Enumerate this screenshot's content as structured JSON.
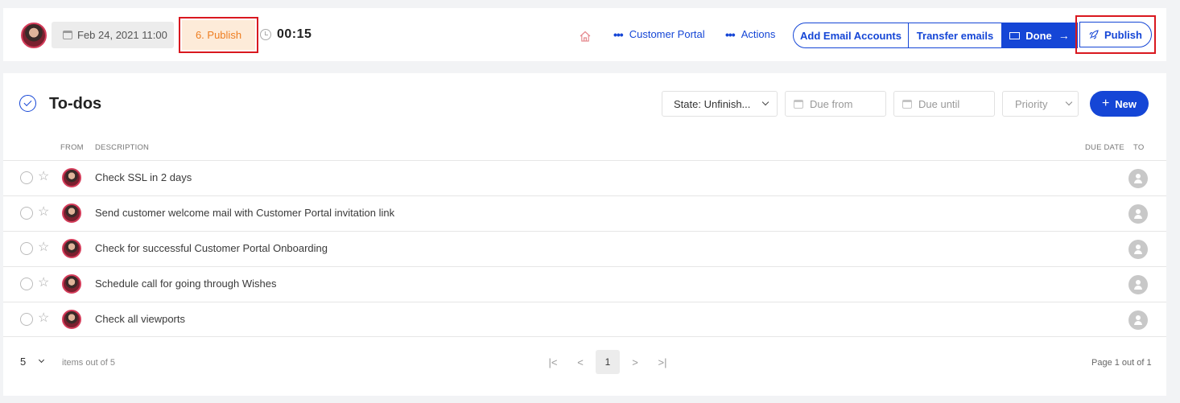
{
  "header": {
    "date": "Feb 24, 2021 11:00",
    "stage": "6. Publish",
    "timer": "00:15",
    "nav": {
      "customer_portal": "Customer Portal",
      "actions": "Actions"
    },
    "buttons": {
      "add_email_accounts": "Add Email Accounts",
      "transfer_emails": "Transfer emails",
      "done": "Done",
      "done_arrow": "→",
      "publish": "Publish"
    },
    "icons": [
      "avatar",
      "calendar-icon",
      "clock-icon",
      "home-icon",
      "mail-icon",
      "rocket-icon"
    ]
  },
  "todos": {
    "title": "To-dos",
    "filters": {
      "state": "State: Unfinish...",
      "due_from": "Due from",
      "due_until": "Due until",
      "priority": "Priority"
    },
    "new_button": "New",
    "new_plus": "+",
    "columns": {
      "from": "FROM",
      "description": "DESCRIPTION",
      "due_date": "DUE DATE",
      "to": "TO"
    },
    "rows": [
      {
        "description": "Check SSL in 2 days"
      },
      {
        "description": "Send customer welcome mail with Customer Portal invitation link"
      },
      {
        "description": "Check for successful Customer Portal Onboarding"
      },
      {
        "description": "Schedule call for going through Wishes"
      },
      {
        "description": "Check all viewports"
      }
    ],
    "pagination": {
      "page_size": "5",
      "items_out": "items out of 5",
      "first": "|<",
      "prev": "<",
      "current_page": "1",
      "next": ">",
      "last": ">|",
      "page_of": "Page 1 out of 1"
    }
  },
  "colors": {
    "accent": "#1546d6",
    "stage_text": "#ee7d20",
    "stage_bg": "#fdebd9",
    "highlight_border": "#d9181f",
    "background": "#f2f3f5"
  }
}
